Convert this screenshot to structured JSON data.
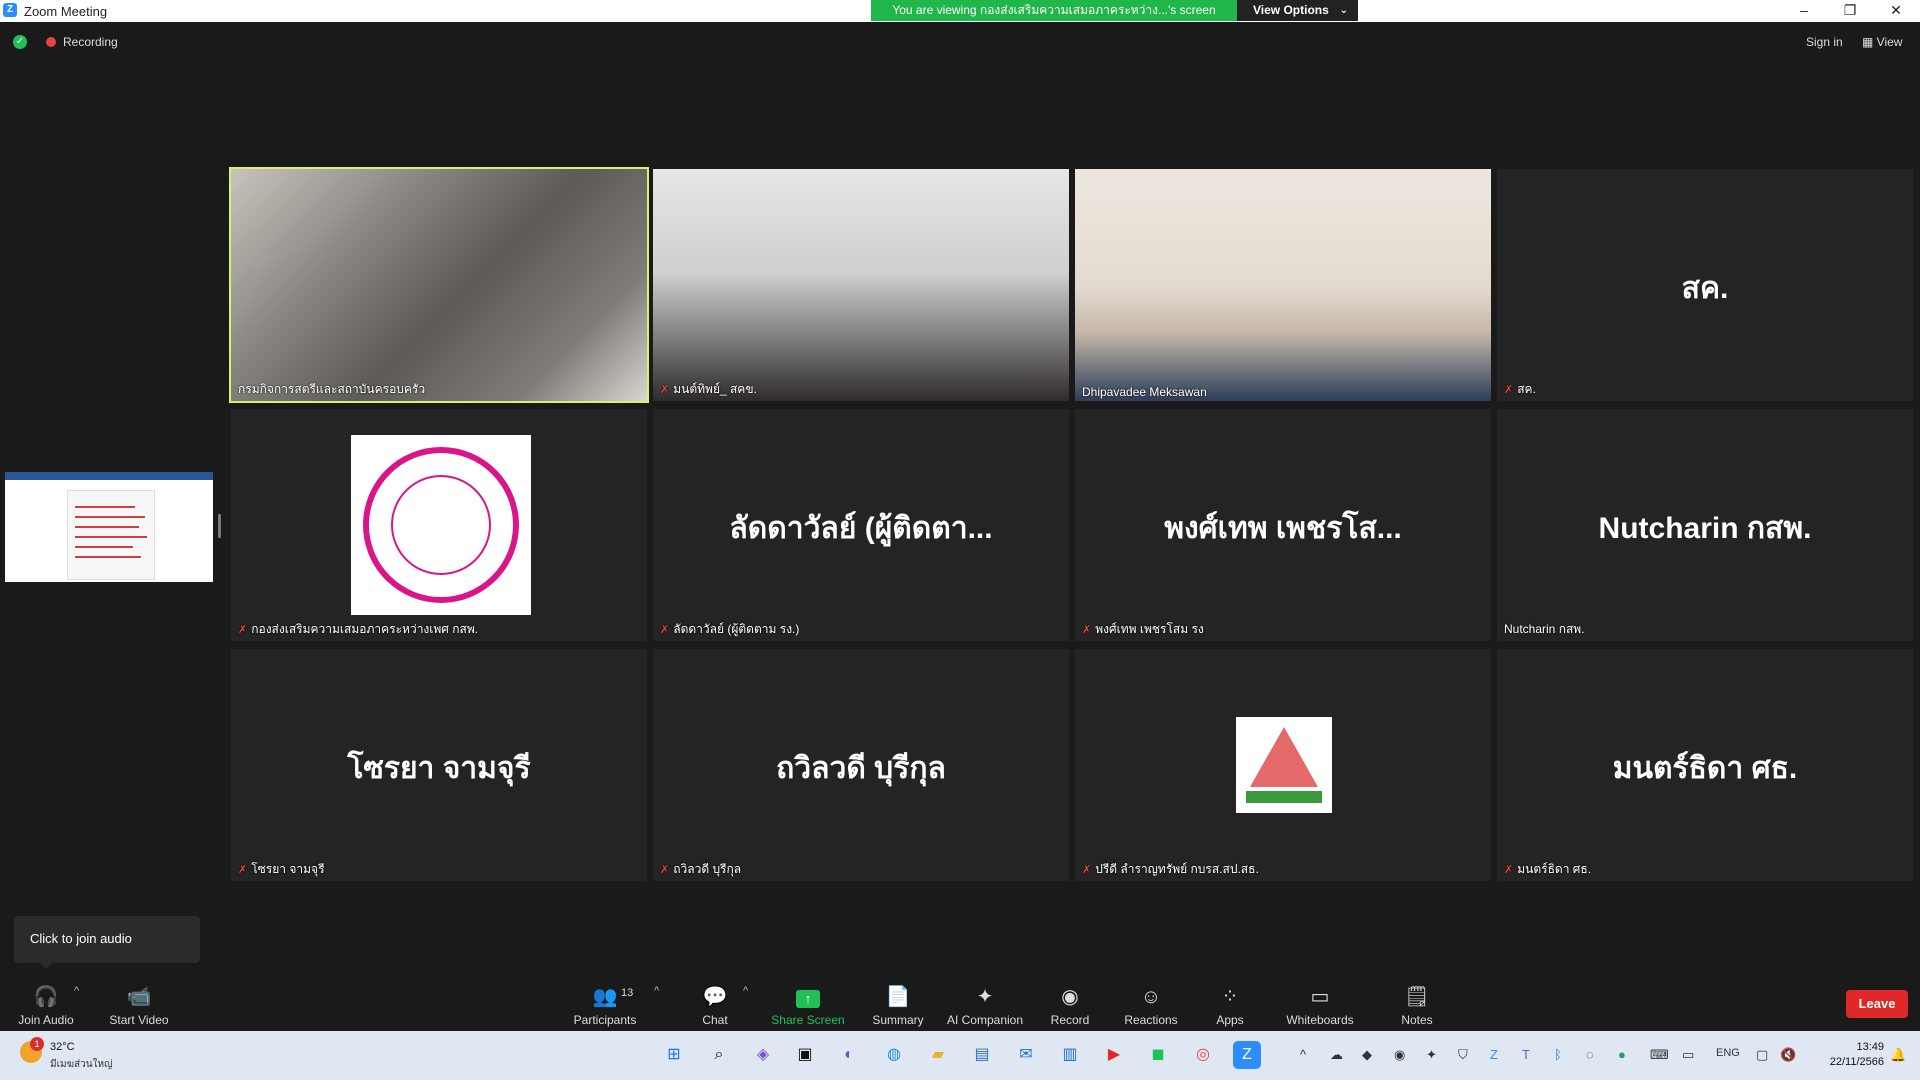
{
  "window": {
    "title": "Zoom Meeting",
    "viewing_banner": "You are viewing กองส่งเสริมความเสมอภาคระหว่าง...'s screen",
    "view_options": "View Options",
    "min": "–",
    "max": "❐",
    "close": "✕"
  },
  "status": {
    "recording": "Recording",
    "sign_in": "Sign in",
    "view": "View"
  },
  "tiles": [
    {
      "name": "กรมกิจการสตรีและสถาบันครอบครัว",
      "big": "",
      "muted": false
    },
    {
      "name": "มนต์ทิพย์_ สคข.",
      "big": "",
      "muted": true
    },
    {
      "name": "Dhipavadee Meksawan",
      "big": "",
      "muted": false
    },
    {
      "name": "สค.",
      "big": "สค.",
      "muted": true
    },
    {
      "name": "กองส่งเสริมความเสมอภาคระหว่างเพศ กสพ.",
      "big": "",
      "muted": true
    },
    {
      "name": "ลัดดาวัลย์ (ผู้ติดตาม รง.)",
      "big": "ลัดดาวัลย์ (ผู้ติดตา...",
      "muted": true
    },
    {
      "name": "พงศ์เทพ เพชรโสม รง",
      "big": "พงศ์เทพ เพชรโส...",
      "muted": true
    },
    {
      "name": "Nutcharin กสพ.",
      "big": "Nutcharin กสพ.",
      "muted": false
    },
    {
      "name": "โซรยา จามจุรี",
      "big": "โซรยา จามจุรี",
      "muted": true
    },
    {
      "name": "ถวิลวดี บุรีกุล",
      "big": "ถวิลวดี บุรีกุล",
      "muted": true
    },
    {
      "name": "ปรีดี ลำราญทรัพย์ กบรส.สป.สธ.",
      "big": "",
      "muted": true
    },
    {
      "name": "มนตร์ธิดา ศธ.",
      "big": "มนตร์ธิดา ศธ.",
      "muted": true
    }
  ],
  "audio_popup": "Click to join audio",
  "toolbar": {
    "join_audio": "Join Audio",
    "start_video": "Start Video",
    "participants": "Participants",
    "participants_count": "13",
    "chat": "Chat",
    "share_screen": "Share Screen",
    "summary": "Summary",
    "ai_companion": "AI Companion",
    "record": "Record",
    "reactions": "Reactions",
    "apps": "Apps",
    "whiteboards": "Whiteboards",
    "notes": "Notes",
    "leave": "Leave"
  },
  "taskbar": {
    "weather_badge": "1",
    "temperature": "32°C",
    "weather_desc": "มีเมฆส่วนใหญ่",
    "lang": "ENG",
    "time": "13:49",
    "date": "22/11/2566"
  },
  "colors": {
    "active_speaker": "#d7f36a",
    "share_green": "#21c15a",
    "leave_red": "#e02828",
    "muted_red": "#e8433a"
  }
}
